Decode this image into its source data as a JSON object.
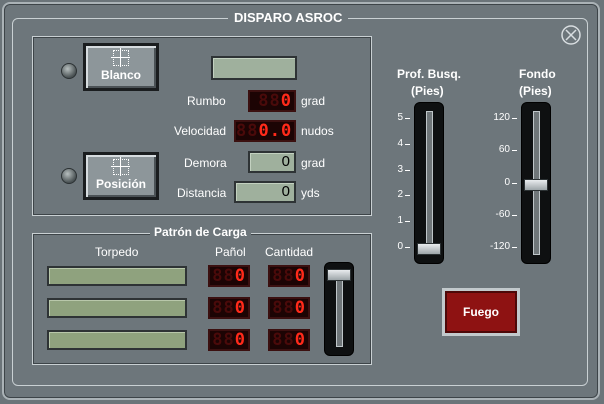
{
  "title": "DISPARO ASROC",
  "target": {
    "blanco_label": "Blanco",
    "posicion_label": "Posición",
    "rumbo_label": "Rumbo",
    "rumbo_digits_dim": "88",
    "rumbo_value": "0",
    "rumbo_unit": "grad",
    "velocidad_label": "Velocidad",
    "velocidad_digits_dim": "88",
    "velocidad_value": "0.0",
    "velocidad_unit": "nudos",
    "demora_label": "Demora",
    "demora_value": "0",
    "demora_unit": "grad",
    "distancia_label": "Distancia",
    "distancia_value": "0",
    "distancia_unit": "yds"
  },
  "load": {
    "title": "Patrón de Carga",
    "col_torpedo": "Torpedo",
    "col_panol": "Pañol",
    "col_cantidad": "Cantidad",
    "rows": [
      {
        "panol_dim": "88",
        "panol": "0",
        "cantidad_dim": "88",
        "cantidad": "0"
      },
      {
        "panol_dim": "88",
        "panol": "0",
        "cantidad_dim": "88",
        "cantidad": "0"
      },
      {
        "panol_dim": "88",
        "panol": "0",
        "cantidad_dim": "88",
        "cantidad": "0"
      }
    ]
  },
  "prof_busq": {
    "label_line1": "Prof. Busq.",
    "label_line2": "(Pies)",
    "ticks": [
      "5",
      "4",
      "3",
      "2",
      "1",
      "0"
    ],
    "value": 0
  },
  "fondo": {
    "label_line1": "Fondo",
    "label_line2": "(Pies)",
    "ticks": [
      "120",
      "60",
      "0",
      "-60",
      "-120"
    ],
    "value": 0
  },
  "fire_label": "Fuego",
  "colors": {
    "panel": "#6d767b",
    "led_lit": "#ff2a1a",
    "fire_button": "#8e1212",
    "display_green": "#9fb09d"
  }
}
